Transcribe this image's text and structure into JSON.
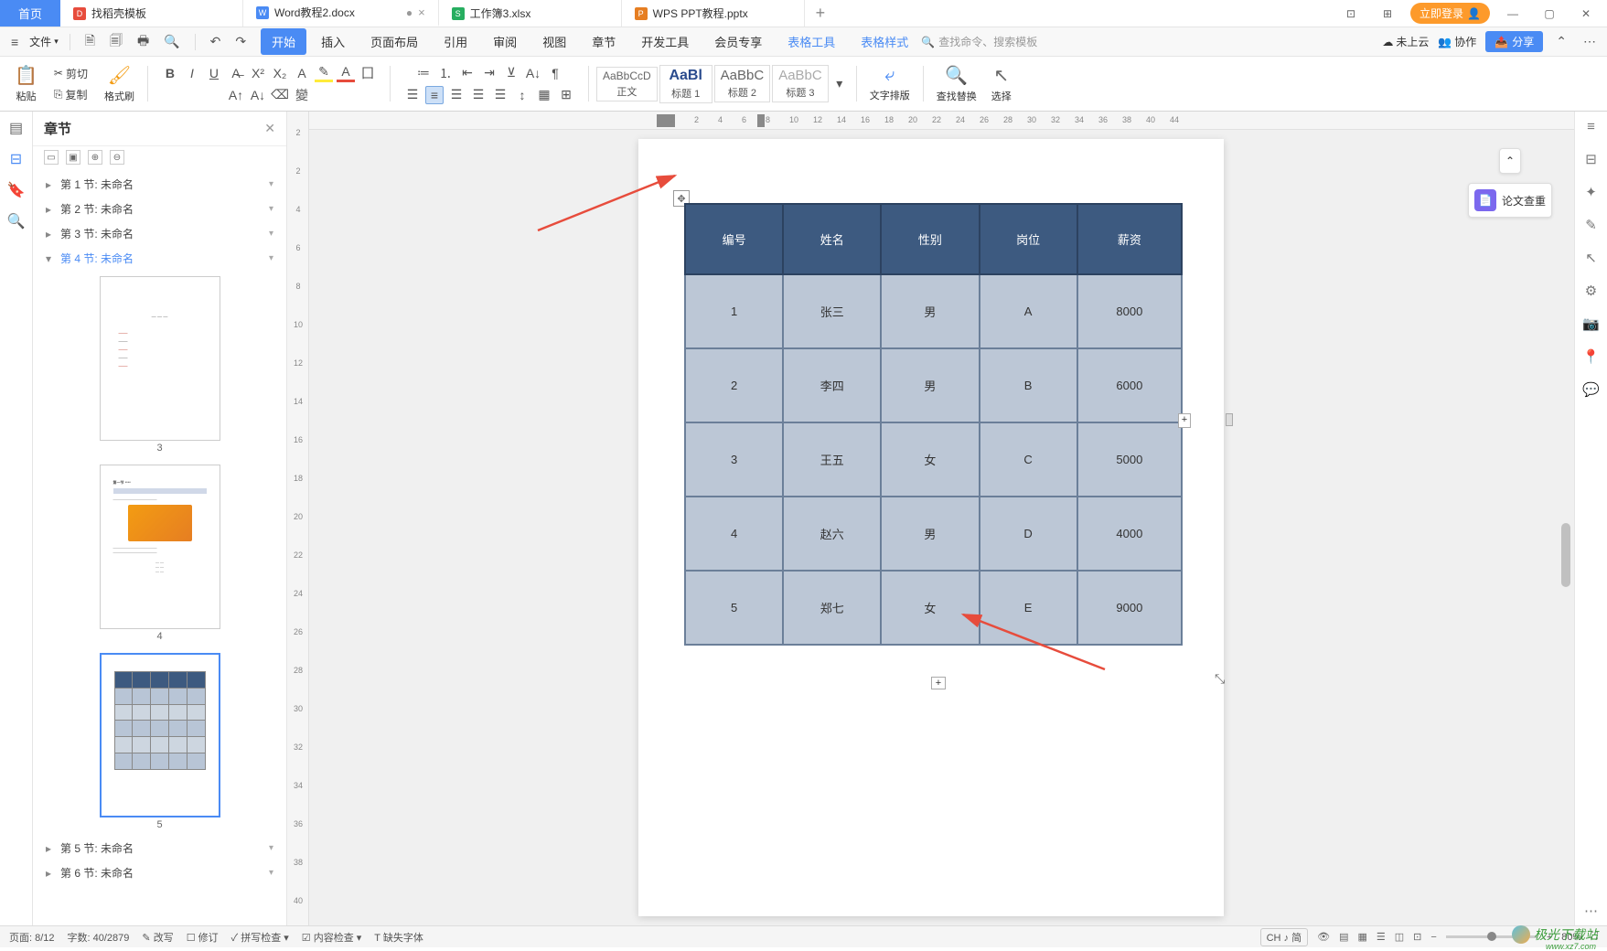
{
  "titlebar": {
    "home": "首页",
    "tabs": [
      {
        "icon_bg": "#e74c3c",
        "icon_txt": "D",
        "label": "找稻壳模板"
      },
      {
        "icon_bg": "#4a8bf4",
        "icon_txt": "W",
        "label": "Word教程2.docx",
        "active": true,
        "dirty": "●"
      },
      {
        "icon_bg": "#27ae60",
        "icon_txt": "S",
        "label": "工作簿3.xlsx"
      },
      {
        "icon_bg": "#e67e22",
        "icon_txt": "P",
        "label": "WPS PPT教程.pptx"
      }
    ],
    "login": "立即登录",
    "grid1": "⊞",
    "grid2": "⊟"
  },
  "ribbon": {
    "file": "文件",
    "tabs": [
      "开始",
      "插入",
      "页面布局",
      "引用",
      "审阅",
      "视图",
      "章节",
      "开发工具",
      "会员专享",
      "表格工具",
      "表格样式"
    ],
    "active_index": 0,
    "blue_start": 9,
    "search_placeholder": "查找命令、搜索模板",
    "not_uploaded": "未上云",
    "coop": "协作",
    "share": "分享"
  },
  "toolbar": {
    "paste": "粘贴",
    "cut": "剪切",
    "copy": "复制",
    "fmt": "格式刷",
    "styles": [
      {
        "preview": "AaBbCcD",
        "label": "正文"
      },
      {
        "preview": "AaBl",
        "label": "标题 1"
      },
      {
        "preview": "AaBbC",
        "label": "标题 2"
      },
      {
        "preview": "AaBbC",
        "label": "标题 3"
      }
    ],
    "text_wrap": "文字排版",
    "find_replace": "查找替换",
    "select": "选择"
  },
  "nav": {
    "title": "章节",
    "items": [
      {
        "label": "第 1 节: 未命名"
      },
      {
        "label": "第 2 节: 未命名"
      },
      {
        "label": "第 3 节: 未命名"
      },
      {
        "label": "第 4 节: 未命名",
        "sel": true,
        "expanded": true
      },
      {
        "label": "第 5 节: 未命名"
      },
      {
        "label": "第 6 节: 未命名"
      }
    ],
    "thumb_labels": [
      "3",
      "4",
      "5"
    ]
  },
  "hruler_ticks": [
    "2",
    "2",
    "4",
    "6",
    "8",
    "10",
    "12",
    "14",
    "16",
    "18",
    "20",
    "22",
    "24",
    "26",
    "28",
    "30",
    "32",
    "34",
    "36",
    "38",
    "40",
    "44"
  ],
  "vruler_ticks": [
    "2",
    "2",
    "4",
    "6",
    "8",
    "10",
    "12",
    "14",
    "16",
    "18",
    "20",
    "22",
    "24",
    "26",
    "28",
    "30",
    "32",
    "34",
    "36",
    "38",
    "40"
  ],
  "table": {
    "headers": [
      "编号",
      "姓名",
      "性别",
      "岗位",
      "薪资"
    ],
    "rows": [
      [
        "1",
        "张三",
        "男",
        "A",
        "8000"
      ],
      [
        "2",
        "李四",
        "男",
        "B",
        "6000"
      ],
      [
        "3",
        "王五",
        "女",
        "C",
        "5000"
      ],
      [
        "4",
        "赵六",
        "男",
        "D",
        "4000"
      ],
      [
        "5",
        "郑七",
        "女",
        "E",
        "9000"
      ]
    ]
  },
  "float": {
    "check": "论文查重"
  },
  "status": {
    "page": "页面: 8/12",
    "words": "字数: 40/2879",
    "rewrite": "改写",
    "revise": "修订",
    "spell": "拼写检查",
    "content": "内容检查",
    "fonts": "缺失字体",
    "ime": "CH ♪ 简",
    "zoom": "80%"
  },
  "watermark": {
    "text": "极光下载站",
    "url": "www.xz7.com"
  }
}
